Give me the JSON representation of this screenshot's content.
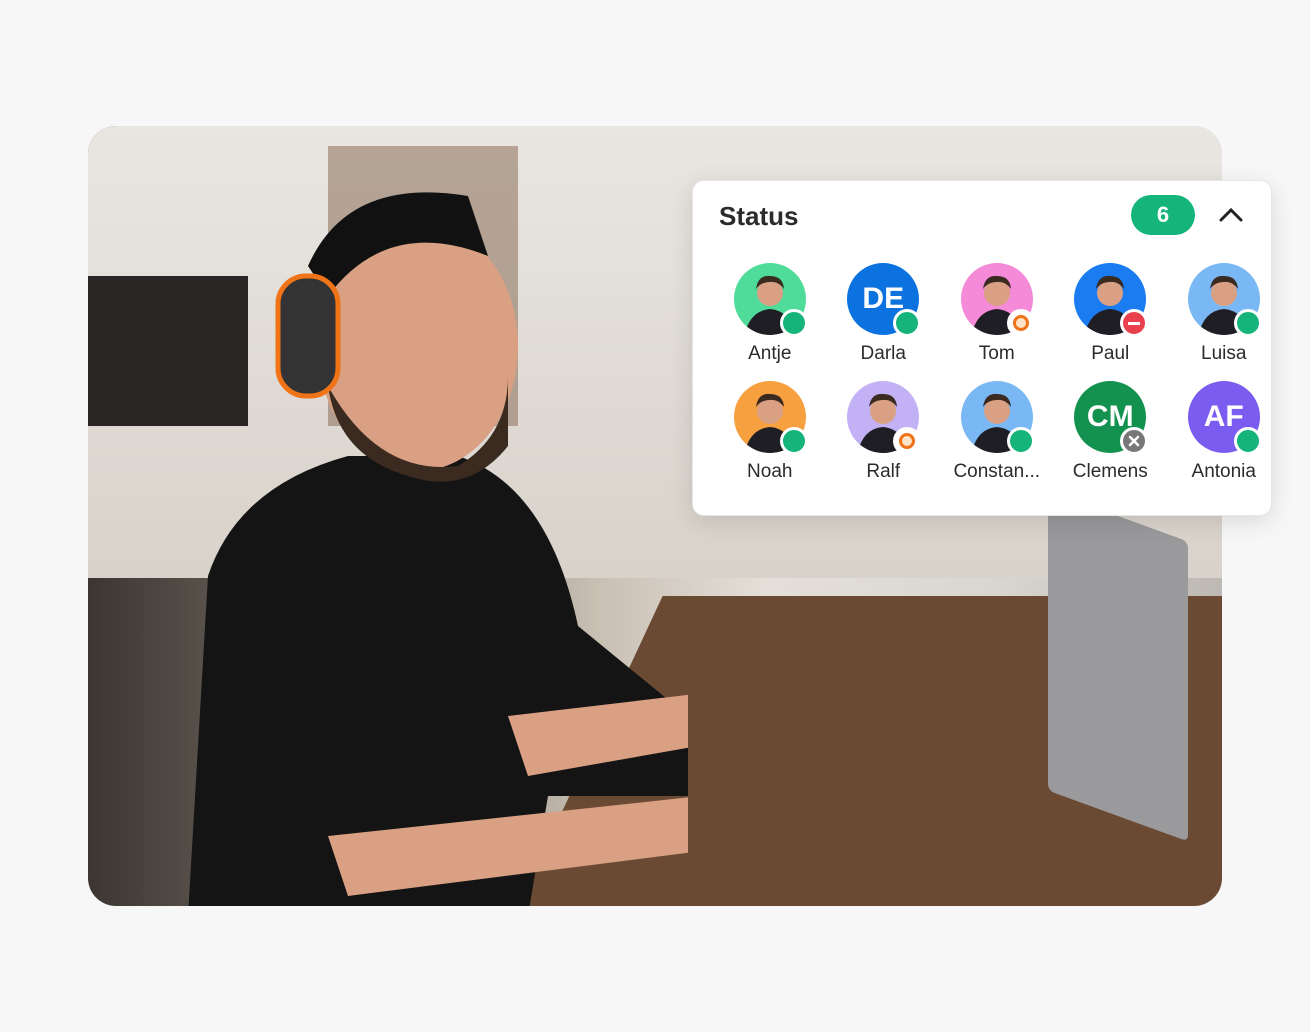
{
  "panel": {
    "title": "Status",
    "count": "6",
    "collapse_icon": "chevron-up-icon"
  },
  "colors": {
    "online": "#14b47a",
    "away": "#f07317",
    "busy": "#e8414d",
    "offline": "#777777"
  },
  "people": [
    {
      "name": "Antje",
      "initials": "",
      "bg": "#4fdc9a",
      "status": "online"
    },
    {
      "name": "Darla",
      "initials": "DE",
      "bg": "#0b72e0",
      "status": "online"
    },
    {
      "name": "Tom",
      "initials": "",
      "bg": "#f48ad8",
      "status": "away"
    },
    {
      "name": "Paul",
      "initials": "",
      "bg": "#1a7cf0",
      "status": "busy"
    },
    {
      "name": "Luisa",
      "initials": "",
      "bg": "#7ab8f5",
      "status": "online"
    },
    {
      "name": "Noah",
      "initials": "",
      "bg": "#f7a040",
      "status": "online"
    },
    {
      "name": "Ralf",
      "initials": "",
      "bg": "#c2b2f5",
      "status": "away"
    },
    {
      "name": "Constan...",
      "initials": "",
      "bg": "#7ab8f5",
      "status": "online"
    },
    {
      "name": "Clemens",
      "initials": "CM",
      "bg": "#13914f",
      "status": "offline"
    },
    {
      "name": "Antonia",
      "initials": "AF",
      "bg": "#7b5cf0",
      "status": "online"
    }
  ]
}
